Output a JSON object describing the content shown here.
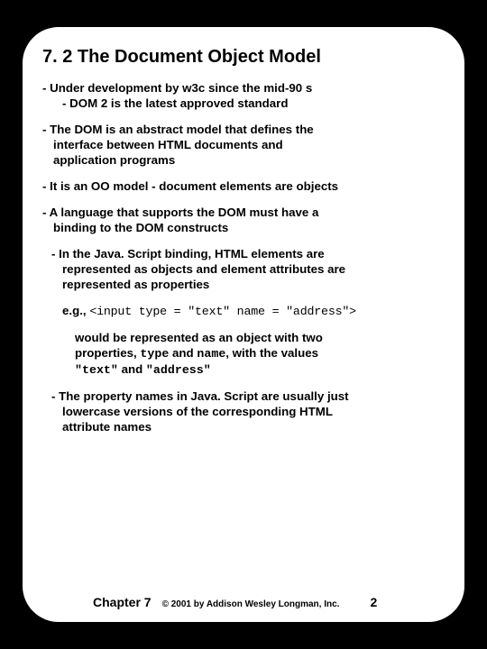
{
  "title": "7. 2 The Document Object Model",
  "bullets": {
    "b1": "- Under development by w3c since the mid-90 s",
    "b1a": "- DOM 2 is the latest approved standard",
    "b2": "- The DOM is an abstract model that defines the",
    "b2a": "interface between HTML documents and",
    "b2b": "application programs",
    "b3": "- It is an OO model - document elements are objects",
    "b4": "- A language that supports the DOM must have a",
    "b4a": "binding to the DOM constructs",
    "b5": "- In the Java. Script binding, HTML elements are",
    "b5a": "represented as objects and element attributes are",
    "b5b": "represented as properties",
    "eg_label": "e.g.,",
    "eg_code": "<input type = \"text\" name = \"address\">",
    "b6a": "would be represented as an object with two",
    "b6b": "properties, ",
    "b6c": "type",
    "b6d": " and ",
    "b6e": "name",
    "b6f": ", with the values",
    "b6g": "\"text\"",
    "b6h": " and ",
    "b6i": "\"address\"",
    "b7": "- The property names in Java. Script are usually just",
    "b7a": "lowercase versions of the corresponding HTML",
    "b7b": "attribute names"
  },
  "footer": {
    "chapter": "Chapter 7",
    "copyright": "© 2001 by Addison Wesley Longman, Inc.",
    "page": "2"
  }
}
